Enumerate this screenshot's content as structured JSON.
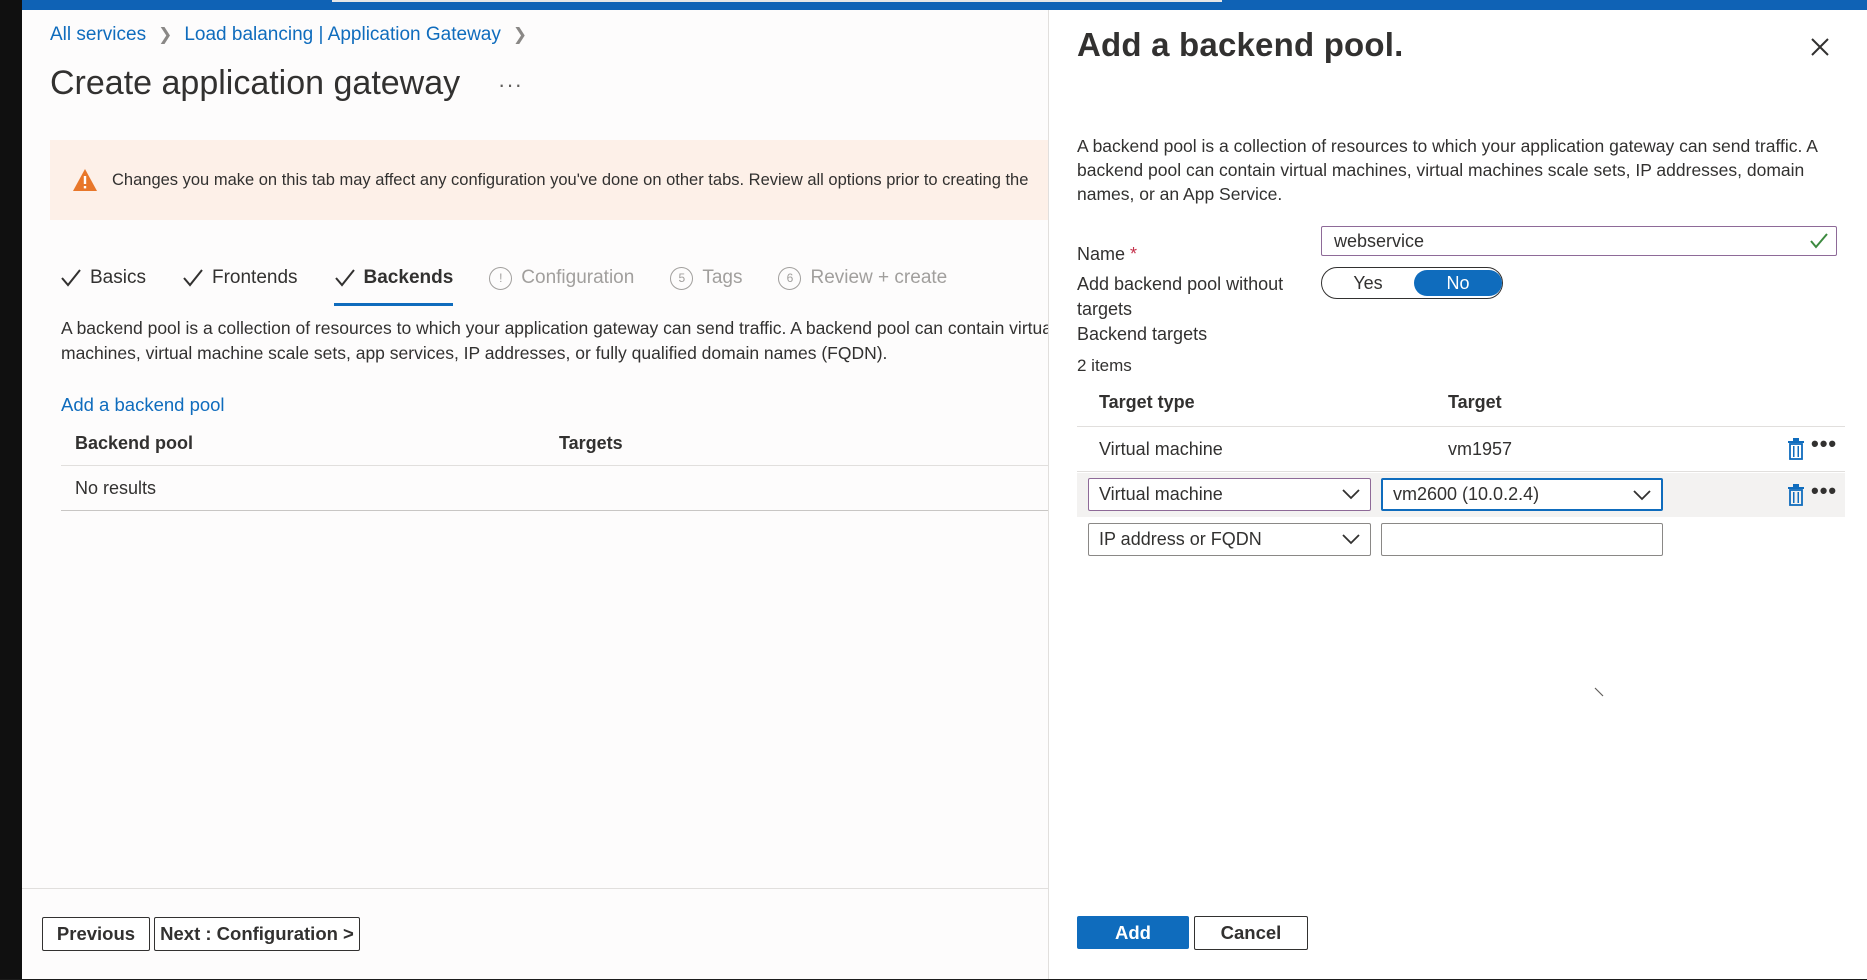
{
  "breadcrumb": {
    "items": [
      "All services",
      "Load balancing | Application Gateway"
    ]
  },
  "page": {
    "title": "Create application gateway",
    "more_label": "···"
  },
  "warning": {
    "text": "Changes you make on this tab may affect any configuration you've done on other tabs. Review all options prior to creating the"
  },
  "tabs": [
    {
      "label": "Basics",
      "state": "done"
    },
    {
      "label": "Frontends",
      "state": "done"
    },
    {
      "label": "Backends",
      "state": "active"
    },
    {
      "label": "Configuration",
      "state": "disabled",
      "marker": "!"
    },
    {
      "label": "Tags",
      "state": "disabled",
      "marker": "5"
    },
    {
      "label": "Review + create",
      "state": "disabled",
      "marker": "6"
    }
  ],
  "backends": {
    "description": "A backend pool is a collection of resources to which your application gateway can send traffic. A backend pool can contain virtual machines, virtual machine scale sets, app services, IP addresses, or fully qualified domain names (FQDN).",
    "add_link": "Add a backend pool",
    "table": {
      "columns": [
        "Backend pool",
        "Targets"
      ],
      "empty_text": "No results"
    }
  },
  "footer": {
    "previous": "Previous",
    "next": "Next : Configuration >"
  },
  "panel": {
    "title": "Add a backend pool.",
    "description": "A backend pool is a collection of resources to which your application gateway can send traffic. A backend pool can contain virtual machines, virtual machines scale sets, IP addresses, domain names, or an App Service.",
    "name_label": "Name",
    "required_mark": "*",
    "name_value": "webservice",
    "without_targets_label": "Add backend pool without targets",
    "toggle": {
      "yes": "Yes",
      "no": "No",
      "selected": "No"
    },
    "backend_targets_label": "Backend targets",
    "items_count": "2 items",
    "targets_table": {
      "columns": [
        "Target type",
        "Target"
      ],
      "rows": [
        {
          "type": "Virtual machine",
          "target": "vm1957"
        },
        {
          "type": "Virtual machine",
          "target": "vm2600 (10.0.2.4)"
        },
        {
          "type": "IP address or FQDN",
          "target": ""
        }
      ]
    },
    "add_button": "Add",
    "cancel_button": "Cancel"
  },
  "colors": {
    "accent": "#0f6cbd",
    "warning_bg": "#fdf0e8",
    "warning_icon": "#e8772a",
    "valid_check": "#3c8a3f"
  }
}
